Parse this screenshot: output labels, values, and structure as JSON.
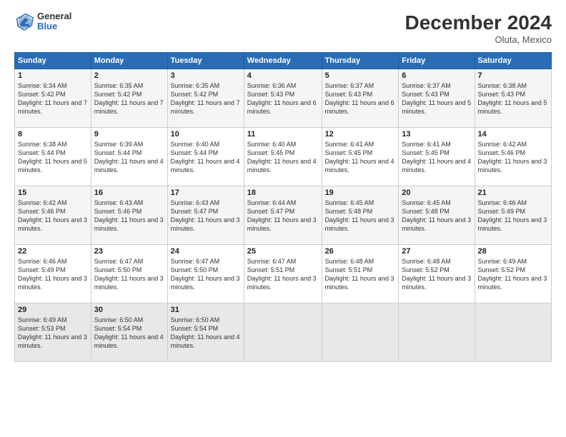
{
  "header": {
    "logo_general": "General",
    "logo_blue": "Blue",
    "month": "December 2024",
    "location": "Oluta, Mexico"
  },
  "days_of_week": [
    "Sunday",
    "Monday",
    "Tuesday",
    "Wednesday",
    "Thursday",
    "Friday",
    "Saturday"
  ],
  "weeks": [
    [
      {
        "day": "1",
        "sunrise": "Sunrise: 6:34 AM",
        "sunset": "Sunset: 5:42 PM",
        "daylight": "Daylight: 11 hours and 7 minutes."
      },
      {
        "day": "2",
        "sunrise": "Sunrise: 6:35 AM",
        "sunset": "Sunset: 5:42 PM",
        "daylight": "Daylight: 11 hours and 7 minutes."
      },
      {
        "day": "3",
        "sunrise": "Sunrise: 6:35 AM",
        "sunset": "Sunset: 5:42 PM",
        "daylight": "Daylight: 11 hours and 7 minutes."
      },
      {
        "day": "4",
        "sunrise": "Sunrise: 6:36 AM",
        "sunset": "Sunset: 5:43 PM",
        "daylight": "Daylight: 11 hours and 6 minutes."
      },
      {
        "day": "5",
        "sunrise": "Sunrise: 6:37 AM",
        "sunset": "Sunset: 5:43 PM",
        "daylight": "Daylight: 11 hours and 6 minutes."
      },
      {
        "day": "6",
        "sunrise": "Sunrise: 6:37 AM",
        "sunset": "Sunset: 5:43 PM",
        "daylight": "Daylight: 11 hours and 5 minutes."
      },
      {
        "day": "7",
        "sunrise": "Sunrise: 6:38 AM",
        "sunset": "Sunset: 5:43 PM",
        "daylight": "Daylight: 11 hours and 5 minutes."
      }
    ],
    [
      {
        "day": "8",
        "sunrise": "Sunrise: 6:38 AM",
        "sunset": "Sunset: 5:44 PM",
        "daylight": "Daylight: 11 hours and 5 minutes."
      },
      {
        "day": "9",
        "sunrise": "Sunrise: 6:39 AM",
        "sunset": "Sunset: 5:44 PM",
        "daylight": "Daylight: 11 hours and 4 minutes."
      },
      {
        "day": "10",
        "sunrise": "Sunrise: 6:40 AM",
        "sunset": "Sunset: 5:44 PM",
        "daylight": "Daylight: 11 hours and 4 minutes."
      },
      {
        "day": "11",
        "sunrise": "Sunrise: 6:40 AM",
        "sunset": "Sunset: 5:45 PM",
        "daylight": "Daylight: 11 hours and 4 minutes."
      },
      {
        "day": "12",
        "sunrise": "Sunrise: 6:41 AM",
        "sunset": "Sunset: 5:45 PM",
        "daylight": "Daylight: 11 hours and 4 minutes."
      },
      {
        "day": "13",
        "sunrise": "Sunrise: 6:41 AM",
        "sunset": "Sunset: 5:45 PM",
        "daylight": "Daylight: 11 hours and 4 minutes."
      },
      {
        "day": "14",
        "sunrise": "Sunrise: 6:42 AM",
        "sunset": "Sunset: 5:46 PM",
        "daylight": "Daylight: 11 hours and 3 minutes."
      }
    ],
    [
      {
        "day": "15",
        "sunrise": "Sunrise: 6:42 AM",
        "sunset": "Sunset: 5:46 PM",
        "daylight": "Daylight: 11 hours and 3 minutes."
      },
      {
        "day": "16",
        "sunrise": "Sunrise: 6:43 AM",
        "sunset": "Sunset: 5:46 PM",
        "daylight": "Daylight: 11 hours and 3 minutes."
      },
      {
        "day": "17",
        "sunrise": "Sunrise: 6:43 AM",
        "sunset": "Sunset: 5:47 PM",
        "daylight": "Daylight: 11 hours and 3 minutes."
      },
      {
        "day": "18",
        "sunrise": "Sunrise: 6:44 AM",
        "sunset": "Sunset: 5:47 PM",
        "daylight": "Daylight: 11 hours and 3 minutes."
      },
      {
        "day": "19",
        "sunrise": "Sunrise: 6:45 AM",
        "sunset": "Sunset: 5:48 PM",
        "daylight": "Daylight: 11 hours and 3 minutes."
      },
      {
        "day": "20",
        "sunrise": "Sunrise: 6:45 AM",
        "sunset": "Sunset: 5:48 PM",
        "daylight": "Daylight: 11 hours and 3 minutes."
      },
      {
        "day": "21",
        "sunrise": "Sunrise: 6:46 AM",
        "sunset": "Sunset: 5:49 PM",
        "daylight": "Daylight: 11 hours and 3 minutes."
      }
    ],
    [
      {
        "day": "22",
        "sunrise": "Sunrise: 6:46 AM",
        "sunset": "Sunset: 5:49 PM",
        "daylight": "Daylight: 11 hours and 3 minutes."
      },
      {
        "day": "23",
        "sunrise": "Sunrise: 6:47 AM",
        "sunset": "Sunset: 5:50 PM",
        "daylight": "Daylight: 11 hours and 3 minutes."
      },
      {
        "day": "24",
        "sunrise": "Sunrise: 6:47 AM",
        "sunset": "Sunset: 5:50 PM",
        "daylight": "Daylight: 11 hours and 3 minutes."
      },
      {
        "day": "25",
        "sunrise": "Sunrise: 6:47 AM",
        "sunset": "Sunset: 5:51 PM",
        "daylight": "Daylight: 11 hours and 3 minutes."
      },
      {
        "day": "26",
        "sunrise": "Sunrise: 6:48 AM",
        "sunset": "Sunset: 5:51 PM",
        "daylight": "Daylight: 11 hours and 3 minutes."
      },
      {
        "day": "27",
        "sunrise": "Sunrise: 6:48 AM",
        "sunset": "Sunset: 5:52 PM",
        "daylight": "Daylight: 11 hours and 3 minutes."
      },
      {
        "day": "28",
        "sunrise": "Sunrise: 6:49 AM",
        "sunset": "Sunset: 5:52 PM",
        "daylight": "Daylight: 11 hours and 3 minutes."
      }
    ],
    [
      {
        "day": "29",
        "sunrise": "Sunrise: 6:49 AM",
        "sunset": "Sunset: 5:53 PM",
        "daylight": "Daylight: 11 hours and 3 minutes."
      },
      {
        "day": "30",
        "sunrise": "Sunrise: 6:50 AM",
        "sunset": "Sunset: 5:54 PM",
        "daylight": "Daylight: 11 hours and 4 minutes."
      },
      {
        "day": "31",
        "sunrise": "Sunrise: 6:50 AM",
        "sunset": "Sunset: 5:54 PM",
        "daylight": "Daylight: 11 hours and 4 minutes."
      },
      null,
      null,
      null,
      null
    ]
  ]
}
